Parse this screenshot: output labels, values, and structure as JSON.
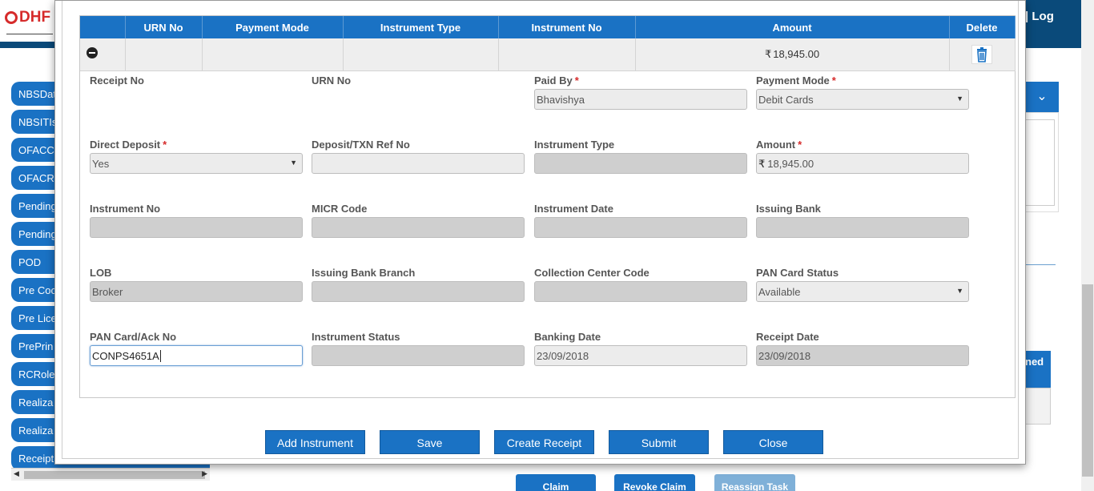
{
  "background": {
    "logo_text": "DHF",
    "log_text": "| Log",
    "sidebar_items": [
      "NBSDat",
      "NBSITIs",
      "OFACC",
      "OFACR",
      "Pending",
      "Pending",
      "POD",
      "Pre Coo",
      "Pre Lice",
      "PrePrin",
      "RCRole",
      "Realiza",
      "Realiza",
      "Receipt"
    ],
    "right_header_partial": "ned",
    "bottom_buttons": [
      "Claim",
      "Revoke Claim",
      "Reassign Task"
    ]
  },
  "grid": {
    "headers": [
      "",
      "URN No",
      "Payment Mode",
      "Instrument Type",
      "Instrument No",
      "Amount",
      "Delete"
    ],
    "row": {
      "urn_no": "",
      "payment_mode": "",
      "instrument_type": "",
      "instrument_no": "",
      "amount": "18,945.00"
    }
  },
  "currency_symbol": "₹",
  "form": {
    "receipt_no": {
      "label": "Receipt No"
    },
    "urn_no": {
      "label": "URN No"
    },
    "paid_by": {
      "label": "Paid By",
      "required": "*",
      "value": "Bhavishya"
    },
    "payment_mode": {
      "label": "Payment Mode",
      "required": "*",
      "value": "Debit Cards"
    },
    "direct_deposit": {
      "label": "Direct Deposit",
      "required": "*",
      "value": "Yes"
    },
    "deposit_ref": {
      "label": "Deposit/TXN Ref No",
      "value": ""
    },
    "instrument_type": {
      "label": "Instrument Type",
      "value": ""
    },
    "amount": {
      "label": "Amount",
      "required": "*",
      "value": "18,945.00"
    },
    "instrument_no": {
      "label": "Instrument No",
      "value": ""
    },
    "micr_code": {
      "label": "MICR Code",
      "value": ""
    },
    "instrument_date": {
      "label": "Instrument Date",
      "value": ""
    },
    "issuing_bank": {
      "label": "Issuing Bank",
      "value": ""
    },
    "lob": {
      "label": "LOB",
      "value": "Broker"
    },
    "issuing_bank_branch": {
      "label": "Issuing Bank Branch",
      "value": ""
    },
    "collection_center_code": {
      "label": "Collection Center Code",
      "value": ""
    },
    "pan_card_status": {
      "label": "PAN Card Status",
      "value": "Available"
    },
    "pan_card_no": {
      "label": "PAN Card/Ack No",
      "value": "CONPS4651A"
    },
    "instrument_status": {
      "label": "Instrument Status",
      "value": ""
    },
    "banking_date": {
      "label": "Banking Date",
      "value": "23/09/2018"
    },
    "receipt_date": {
      "label": "Receipt Date",
      "value": "23/09/2018"
    }
  },
  "actions": {
    "add_instrument": "Add Instrument",
    "save": "Save",
    "create_receipt": "Create Receipt",
    "submit": "Submit",
    "close": "Close"
  },
  "colors": {
    "primary": "#1a72c4",
    "required": "#d62b2b",
    "brand_red": "#d62b2b"
  }
}
